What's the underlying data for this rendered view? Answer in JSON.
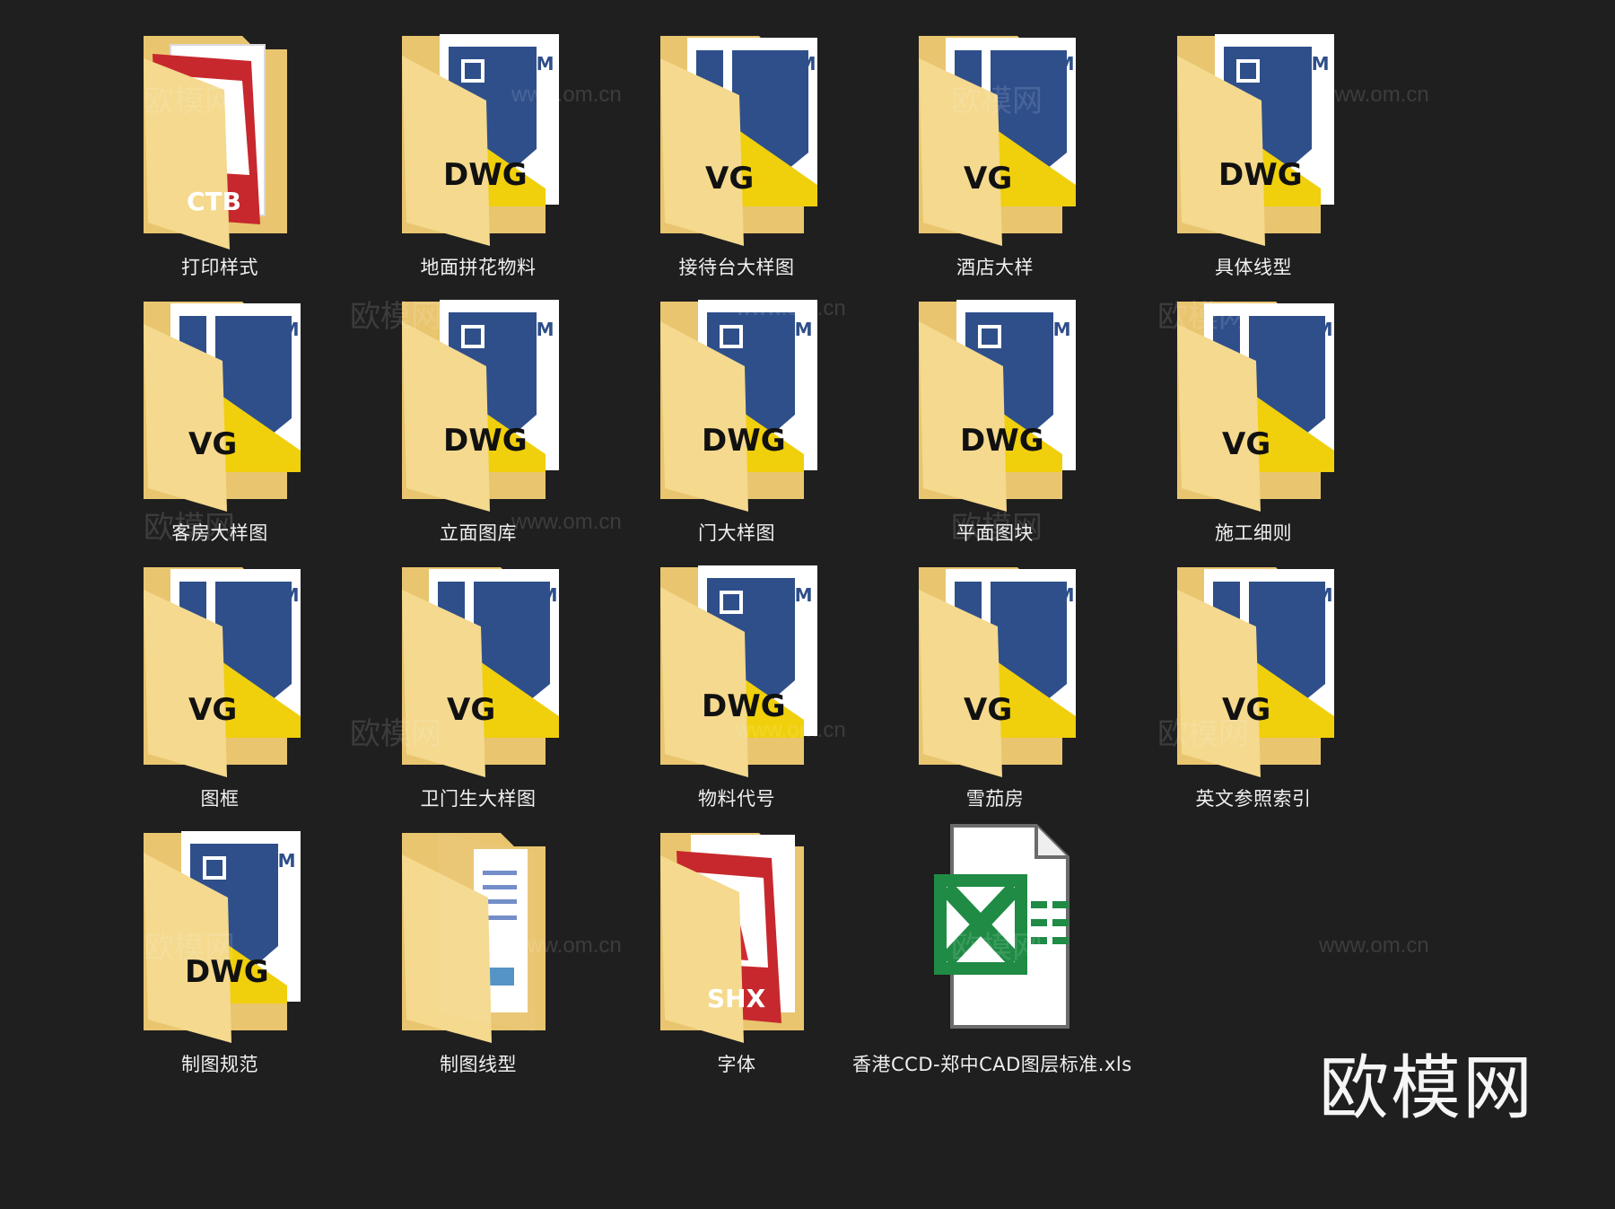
{
  "items": [
    {
      "label": "打印样式",
      "icon": "ctb-folder-icon",
      "badge": "CTB"
    },
    {
      "label": "地面拼花物料",
      "icon": "dwg-folder-icon",
      "badge": "DWG"
    },
    {
      "label": "接待台大样图",
      "icon": "dwg-folder-icon",
      "badge": "VG"
    },
    {
      "label": "酒店大样",
      "icon": "dwg-folder-icon",
      "badge": "VG"
    },
    {
      "label": "具体线型",
      "icon": "dwg-folder-icon",
      "badge": "DWG"
    },
    {
      "label": "客房大样图",
      "icon": "dwg-folder-icon",
      "badge": "VG"
    },
    {
      "label": "立面图库",
      "icon": "dwg-folder-icon",
      "badge": "DWG"
    },
    {
      "label": "门大样图",
      "icon": "dwg-folder-icon",
      "badge": "DWG"
    },
    {
      "label": "平面图块",
      "icon": "dwg-folder-icon",
      "badge": "DWG"
    },
    {
      "label": "施工细则",
      "icon": "dwg-folder-icon",
      "badge": "VG"
    },
    {
      "label": "图框",
      "icon": "dwg-folder-icon",
      "badge": "VG"
    },
    {
      "label": "卫门生大样图",
      "icon": "dwg-folder-icon",
      "badge": "VG"
    },
    {
      "label": "物料代号",
      "icon": "dwg-folder-icon",
      "badge": "DWG"
    },
    {
      "label": "雪茄房",
      "icon": "dwg-folder-icon",
      "badge": "VG"
    },
    {
      "label": "英文参照索引",
      "icon": "dwg-folder-icon",
      "badge": "VG"
    },
    {
      "label": "制图规范",
      "icon": "dwg-folder-icon",
      "badge": "DWG"
    },
    {
      "label": "制图线型",
      "icon": "plain-folder-icon",
      "badge": ""
    },
    {
      "label": "字体",
      "icon": "shx-folder-icon",
      "badge": "SHX"
    },
    {
      "label": "香港CCD-郑中CAD图层标准.xls",
      "icon": "excel-file-icon",
      "badge": ""
    }
  ],
  "watermarks": {
    "brand": "欧模网",
    "url": "www.om.cn"
  },
  "colors": {
    "background": "#1f1f1f",
    "folder": "#f3d58a",
    "dwg_yellow": "#f0cf0c",
    "dwg_blue": "#2d4e87",
    "cad_red": "#b31f24",
    "excel_green": "#1f8b45"
  }
}
